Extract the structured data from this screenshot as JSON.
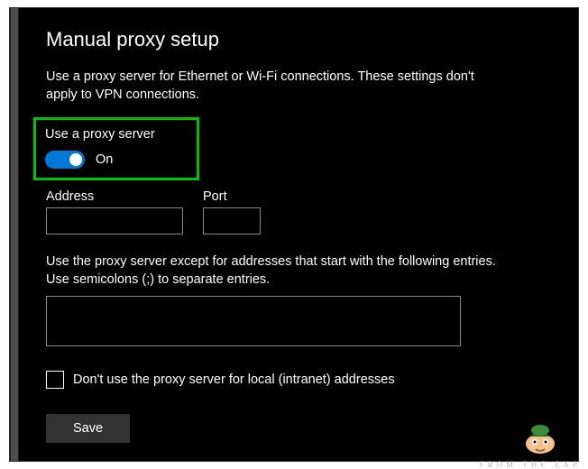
{
  "title": "Manual proxy setup",
  "description": "Use a proxy server for Ethernet or Wi-Fi connections. These settings don't apply to VPN connections.",
  "proxy": {
    "toggle_label": "Use a proxy server",
    "toggle_state": "On",
    "address_label": "Address",
    "address_value": "",
    "port_label": "Port",
    "port_value": ""
  },
  "exceptions": {
    "description": "Use the proxy server except for addresses that start with the following entries. Use semicolons (;) to separate entries.",
    "value": ""
  },
  "local_checkbox": {
    "label": "Don't use the proxy server for local (intranet) addresses",
    "checked": false
  },
  "save_label": "Save",
  "watermark": "FROM THE EXP"
}
